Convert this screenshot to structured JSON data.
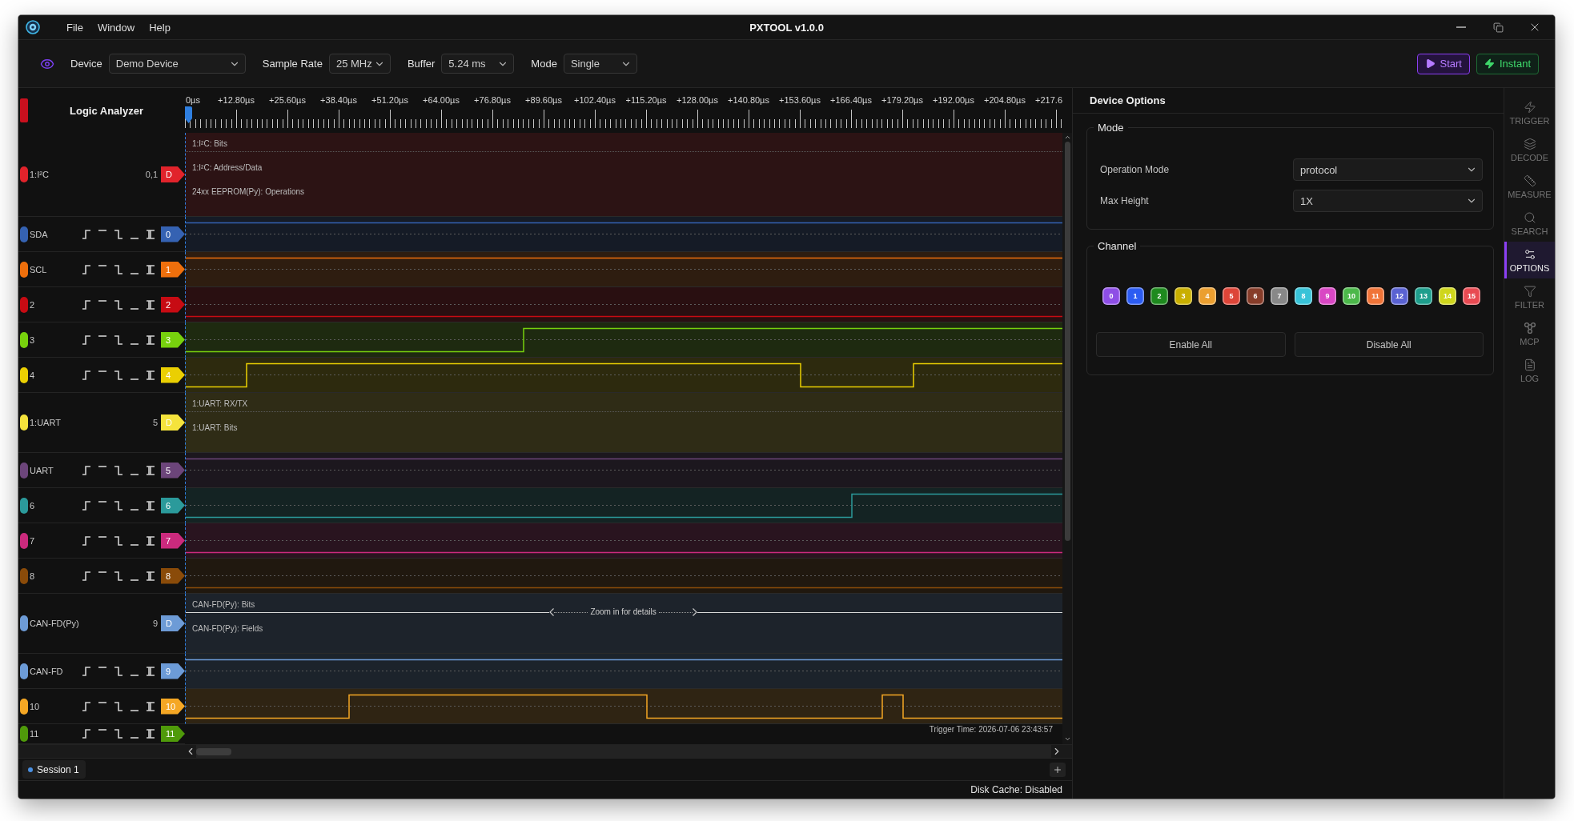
{
  "window": {
    "title": "PXTOOL v1.0.0"
  },
  "menu": [
    {
      "label": "File"
    },
    {
      "label": "Window"
    },
    {
      "label": "Help"
    }
  ],
  "toolbar": {
    "fields": [
      {
        "label": "Device",
        "value": "Demo Device"
      },
      {
        "label": "Sample Rate",
        "value": "25 MHz"
      },
      {
        "label": "Buffer",
        "value": "5.24 ms"
      },
      {
        "label": "Mode",
        "value": "Single"
      }
    ],
    "actions": [
      {
        "label": "Start",
        "kind": "start"
      },
      {
        "label": "Instant",
        "kind": "instant"
      }
    ]
  },
  "analyzer": {
    "title": "Logic Analyzer",
    "ruler": [
      "0µs",
      "+12.80µs",
      "+25.60µs",
      "+38.40µs",
      "+51.20µs",
      "+64.00µs",
      "+76.80µs",
      "+89.60µs",
      "+102.40µs",
      "+115.20µs",
      "+128.00µs",
      "+140.80µs",
      "+153.60µs",
      "+166.40µs",
      "+179.20µs",
      "+192.00µs",
      "+204.80µs",
      "+217.6"
    ],
    "channels": [
      {
        "kind": "decoder",
        "name": "1:I²C",
        "probes": "0,1",
        "tag": "D",
        "color": "#e1232b",
        "lanes": [
          {
            "label": "1:I²C: Bits"
          },
          {
            "label": "1:I²C: Address/Data"
          },
          {
            "label": "24xx EEPROM(Py): Operations"
          }
        ]
      },
      {
        "kind": "channel",
        "name": "SDA",
        "tag": "0",
        "color": "#3562b2"
      },
      {
        "kind": "channel",
        "name": "SCL",
        "tag": "1",
        "color": "#ee6f0c"
      },
      {
        "kind": "channel",
        "name": "2",
        "tag": "2",
        "color": "#c70b13"
      },
      {
        "kind": "channel",
        "name": "3",
        "tag": "3",
        "color": "#77d10d"
      },
      {
        "kind": "channel",
        "name": "4",
        "tag": "4",
        "color": "#eacf02"
      },
      {
        "kind": "decoder",
        "name": "1:UART",
        "probes": "5",
        "tag": "D",
        "color": "#f5e33c",
        "lanes": [
          {
            "label": "1:UART: RX/TX"
          },
          {
            "label": "1:UART: Bits"
          }
        ]
      },
      {
        "kind": "channel",
        "name": "UART",
        "tag": "5",
        "color": "#6c457a"
      },
      {
        "kind": "channel",
        "name": "6",
        "tag": "6",
        "color": "#2b9a9b"
      },
      {
        "kind": "channel",
        "name": "7",
        "tag": "7",
        "color": "#cb2a7d"
      },
      {
        "kind": "channel",
        "name": "8",
        "tag": "8",
        "color": "#8a4b09"
      },
      {
        "kind": "decoder",
        "name": "CAN-FD(Py)",
        "probes": "9",
        "tag": "D",
        "color": "#6d9bd6",
        "lanes": [
          {
            "label": "CAN-FD(Py): Bits",
            "hint": "Zoom in for details"
          },
          {
            "label": "CAN-FD(Py): Fields"
          }
        ]
      },
      {
        "kind": "channel",
        "name": "CAN-FD",
        "tag": "9",
        "color": "#6c9bd7"
      },
      {
        "kind": "channel",
        "name": "10",
        "tag": "10",
        "color": "#f5a724"
      },
      {
        "kind": "channel",
        "name": "11",
        "tag": "11",
        "color": "#4f9a0a"
      }
    ],
    "trigger_time": "Trigger Time: 2026-07-06 23:43:57"
  },
  "sessions": [
    {
      "label": "Session 1",
      "selected": true
    }
  ],
  "status_bar": {
    "text": "Disk Cache: Disabled"
  },
  "options_panel": {
    "title": "Device Options",
    "mode_group": {
      "legend": "Mode",
      "fields": [
        {
          "label": "Operation Mode",
          "value": "protocol"
        },
        {
          "label": "Max Height",
          "value": "1X"
        }
      ]
    },
    "channel_group": {
      "legend": "Channel",
      "chips": [
        {
          "label": "0",
          "color": "#8e4ee6"
        },
        {
          "label": "1",
          "color": "#2c5cf2"
        },
        {
          "label": "2",
          "color": "#1e8a1e"
        },
        {
          "label": "3",
          "color": "#c9af00"
        },
        {
          "label": "4",
          "color": "#eb9f30"
        },
        {
          "label": "5",
          "color": "#dd4538"
        },
        {
          "label": "6",
          "color": "#873d2a"
        },
        {
          "label": "7",
          "color": "#888888"
        },
        {
          "label": "8",
          "color": "#38c3d8"
        },
        {
          "label": "9",
          "color": "#d947c4"
        },
        {
          "label": "10",
          "color": "#4cb84a"
        },
        {
          "label": "11",
          "color": "#f07438"
        },
        {
          "label": "12",
          "color": "#5a62d2"
        },
        {
          "label": "13",
          "color": "#1e9e8c"
        },
        {
          "label": "14",
          "color": "#cfd61c"
        },
        {
          "label": "15",
          "color": "#e84a52"
        }
      ],
      "buttons": [
        {
          "label": "Enable All"
        },
        {
          "label": "Disable All"
        }
      ]
    }
  },
  "side_tabs": [
    {
      "label": "TRIGGER",
      "selected": false
    },
    {
      "label": "DECODE",
      "selected": false
    },
    {
      "label": "MEASURE",
      "selected": false
    },
    {
      "label": "SEARCH",
      "selected": false
    },
    {
      "label": "OPTIONS",
      "selected": true
    },
    {
      "label": "FILTER",
      "selected": false
    },
    {
      "label": "MCP",
      "selected": false
    },
    {
      "label": "LOG",
      "selected": false
    }
  ]
}
